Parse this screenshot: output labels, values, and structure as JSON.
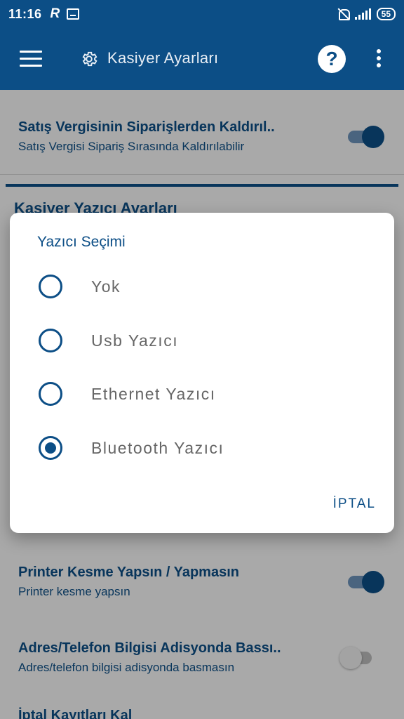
{
  "status_bar": {
    "time": "11:16",
    "app_glyph": "R",
    "battery": "55"
  },
  "app_bar": {
    "title": "Kasiyer Ayarları",
    "help_label": "?"
  },
  "preferences": {
    "tax_removal": {
      "title": "Satış Vergisinin Siparişlerden Kaldırıl..",
      "subtitle": "Satış Vergisi Sipariş Sırasında Kaldırılabilir",
      "enabled": true
    },
    "section_title": "Kasiyer Yazıcı Ayarları",
    "printer_cut": {
      "title": "Printer Kesme Yapsın / Yapmasın",
      "subtitle": "Printer kesme yapsın",
      "enabled": true
    },
    "address_phone": {
      "title": "Adres/Telefon Bilgisi Adisyonda Bassı..",
      "subtitle": "Adres/telefon bilgisi adisyonda basmasın",
      "enabled": false
    },
    "partial_next_title": "İptal Kayıtları Kal"
  },
  "dialog": {
    "title": "Yazıcı Seçimi",
    "options": [
      {
        "label": "Yok",
        "selected": false
      },
      {
        "label": "Usb Yazıcı",
        "selected": false
      },
      {
        "label": "Ethernet Yazıcı",
        "selected": false
      },
      {
        "label": "Bluetooth Yazıcı",
        "selected": true
      }
    ],
    "cancel_label": "İPTAL"
  },
  "colors": {
    "primary": "#0c4e86",
    "switch_track_on": "#6e94bb",
    "option_text": "#666666"
  }
}
